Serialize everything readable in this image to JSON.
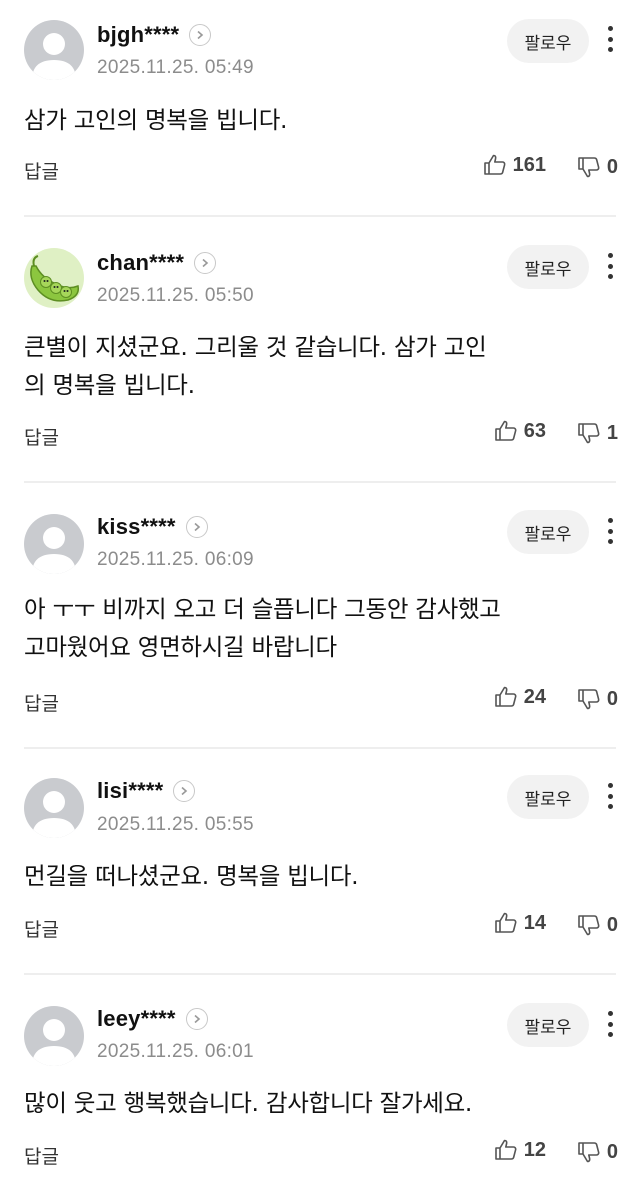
{
  "comments": [
    {
      "username": "bjgh****",
      "timestamp": "2025.11.25. 05:49",
      "text": "삼가 고인의 명복을 빕니다.",
      "follow_label": "팔로우",
      "reply_label": "답글",
      "likes": "161",
      "dislikes": "0",
      "avatar": "default-avatar-icon"
    },
    {
      "username": "chan****",
      "timestamp": "2025.11.25. 05:50",
      "text": "큰별이 지셨군요. 그리울 것 같습니다. 삼가 고인\n의 명복을 빕니다.",
      "follow_label": "팔로우",
      "reply_label": "답글",
      "likes": "63",
      "dislikes": "1",
      "avatar": "pea-pod-avatar"
    },
    {
      "username": "kiss****",
      "timestamp": "2025.11.25. 06:09",
      "text": "아 ㅜㅜ 비까지 오고 더 슬픕니다 그동안 감사했고\n고마웠어요 영면하시길 바랍니다",
      "follow_label": "팔로우",
      "reply_label": "답글",
      "likes": "24",
      "dislikes": "0",
      "avatar": "default-avatar-icon"
    },
    {
      "username": "lisi****",
      "timestamp": "2025.11.25. 05:55",
      "text": "먼길을 떠나셨군요. 명복을 빕니다.",
      "follow_label": "팔로우",
      "reply_label": "답글",
      "likes": "14",
      "dislikes": "0",
      "avatar": "default-avatar-icon"
    },
    {
      "username": "leey****",
      "timestamp": "2025.11.25. 06:01",
      "text": "많이 웃고 행복했습니다. 감사합니다 잘가세요.",
      "follow_label": "팔로우",
      "reply_label": "답글",
      "likes": "12",
      "dislikes": "0",
      "avatar": "default-avatar-icon"
    }
  ],
  "colors": {
    "background": "#ffffff",
    "text": "#111111",
    "timestamp": "#8c8c8c",
    "follow_button_bg": "#f2f2f2",
    "avatar_default_bg": "#c9cbcf",
    "pea_green": "#8cc63f"
  }
}
